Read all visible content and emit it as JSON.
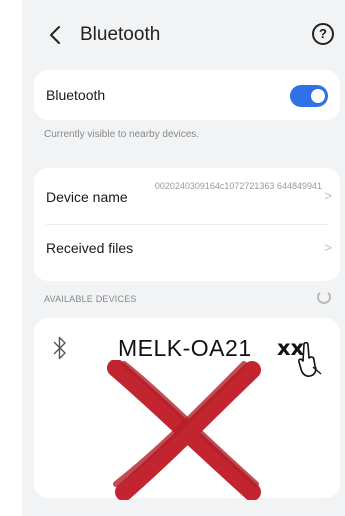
{
  "header": {
    "title": "Bluetooth",
    "back_icon": "back-arrow-icon",
    "help_icon": "help-icon",
    "help_glyph": "?"
  },
  "bluetooth_card": {
    "label": "Bluetooth",
    "enabled": true,
    "toggle_color": "#2f72e8"
  },
  "caption": "Currently visible to nearby devices.",
  "device_card": {
    "device_name_label": "Device name",
    "device_name_value": "0020240309164c1072721363 644849941",
    "received_files_label": "Received files",
    "chevron": ">"
  },
  "available": {
    "section_label": "AVAILABLE DEVICES",
    "devices": [
      {
        "name": "MELK-OA21",
        "scribble": "xx",
        "icon": "bluetooth-icon"
      }
    ],
    "overlay": {
      "mark": "red-x",
      "color": "#c2252f"
    }
  }
}
